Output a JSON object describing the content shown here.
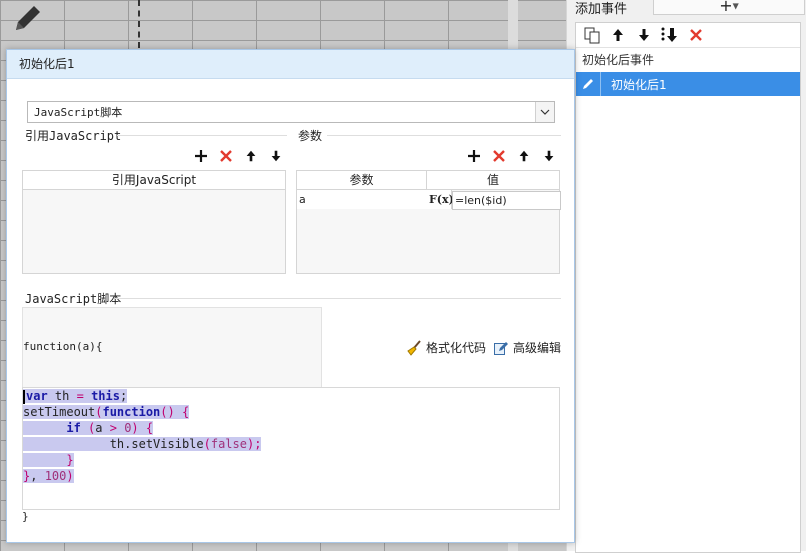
{
  "right_panel": {
    "title": "添加事件",
    "add_symbol": "+",
    "event_group": "初始化后事件",
    "selected_event": "初始化后1",
    "tools": [
      "copy-icon",
      "arrow-up-icon",
      "arrow-down-icon",
      "move-bottom-icon",
      "delete-icon"
    ]
  },
  "dialog": {
    "title": "初始化后1",
    "type_select": "JavaScript脚本",
    "ref_section": {
      "label": "引用JavaScript",
      "column": "引用JavaScript"
    },
    "params_section": {
      "label": "参数",
      "columns": [
        "参数",
        "值"
      ],
      "rows": [
        {
          "name": "a",
          "fx": "F(x)",
          "value": "=len($id)"
        }
      ]
    },
    "script_section": {
      "label": "JavaScript脚本",
      "func_header": "function(a){",
      "format_btn": "格式化代码",
      "advanced_btn": "高级编辑",
      "closing": "}"
    },
    "code": {
      "line1": {
        "kw1": "var",
        "t1": " th ",
        "op": "=",
        "sp": " ",
        "kw2": "this",
        "semi": ";"
      },
      "line2": {
        "fn": "setTimeout",
        "p1": "(",
        "kw": "function",
        "p2": "() {"
      },
      "line3": {
        "kw": "if",
        "p1": " (",
        "id": "a ",
        "op": ">",
        "sp": " ",
        "n": "0",
        "p2": ") {"
      },
      "line4": {
        "obj": "th.setVisible",
        "p1": "(",
        "kw": "false",
        "p2": ");"
      },
      "line5": {
        "b": "}"
      },
      "line6": {
        "b": "}",
        "c": ", ",
        "n": "100",
        "p": ")"
      }
    }
  },
  "colors": {
    "accent": "#3a8ee6",
    "delete": "#e23a2e",
    "highlight": "#c9c9ef"
  }
}
